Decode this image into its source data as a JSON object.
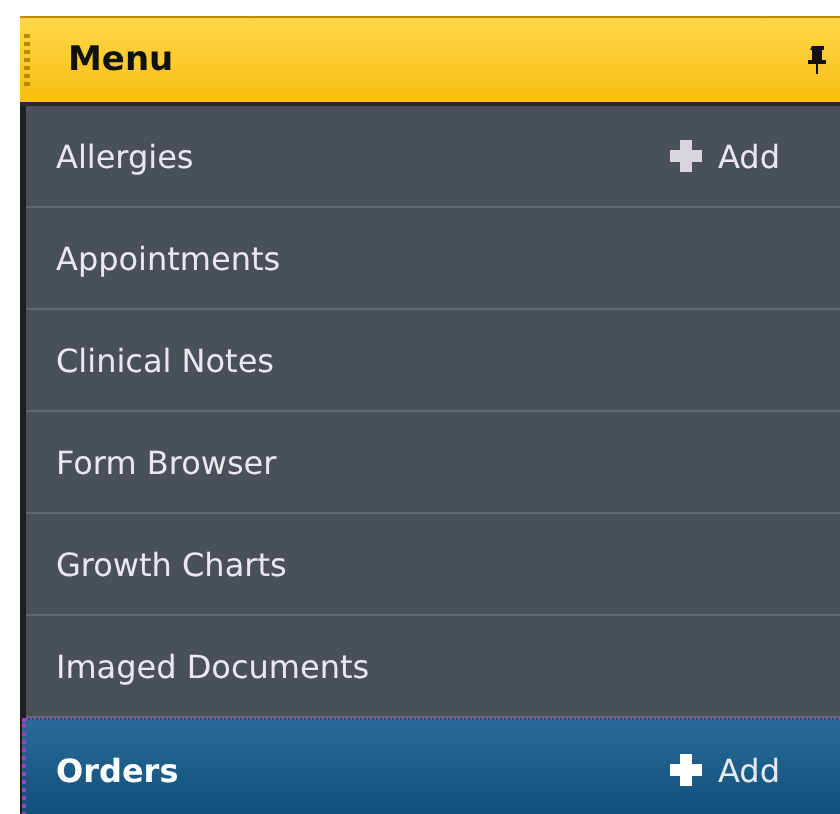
{
  "panel": {
    "title": "Menu"
  },
  "items": [
    {
      "label": "Allergies",
      "action": "Add",
      "selected": false
    },
    {
      "label": "Appointments",
      "selected": false
    },
    {
      "label": "Clinical Notes",
      "selected": false
    },
    {
      "label": "Form Browser",
      "selected": false
    },
    {
      "label": "Growth Charts",
      "selected": false
    },
    {
      "label": "Imaged Documents",
      "selected": false
    },
    {
      "label": "Orders",
      "action": "Add",
      "selected": true
    }
  ]
}
